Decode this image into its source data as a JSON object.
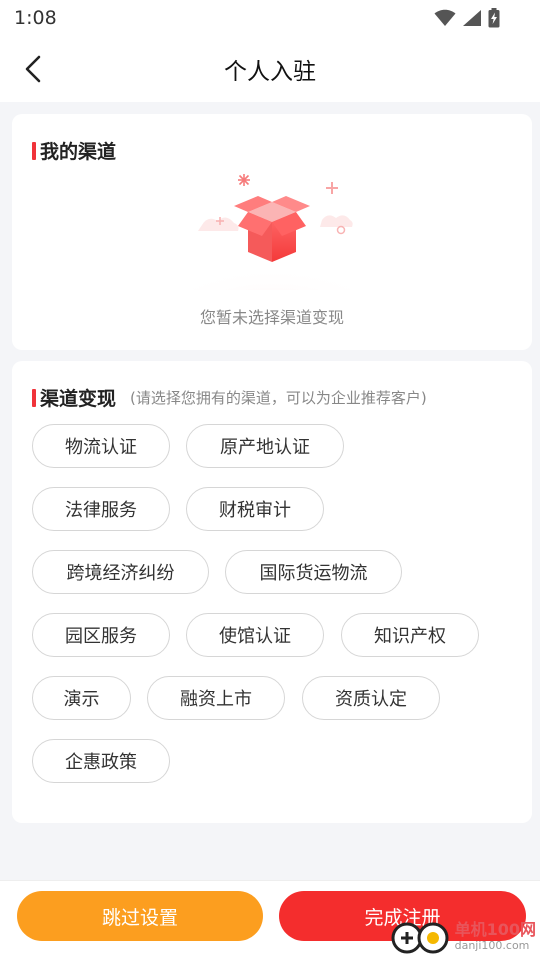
{
  "status_bar": {
    "time": "1:08"
  },
  "nav": {
    "title": "个人入驻"
  },
  "my_channels": {
    "title": "我的渠道",
    "empty_text": "您暂未选择渠道变现"
  },
  "channel_monetize": {
    "title": "渠道变现",
    "hint": "(请选择您拥有的渠道，可以为企业推荐客户)",
    "chips": [
      "物流认证",
      "原产地认证",
      "法律服务",
      "财税审计",
      "跨境经济纠纷",
      "国际货运物流",
      "园区服务",
      "使馆认证",
      "知识产权",
      "演示",
      "融资上市",
      "资质认定",
      "企惠政策"
    ]
  },
  "actions": {
    "skip_label": "跳过设置",
    "finish_label": "完成注册"
  },
  "watermark": {
    "main": "单机100网",
    "sub": "danji100.com"
  },
  "colors": {
    "accent_red": "#f42d2d",
    "accent_orange": "#fc9e1f",
    "section_bar": "#f0333a"
  }
}
